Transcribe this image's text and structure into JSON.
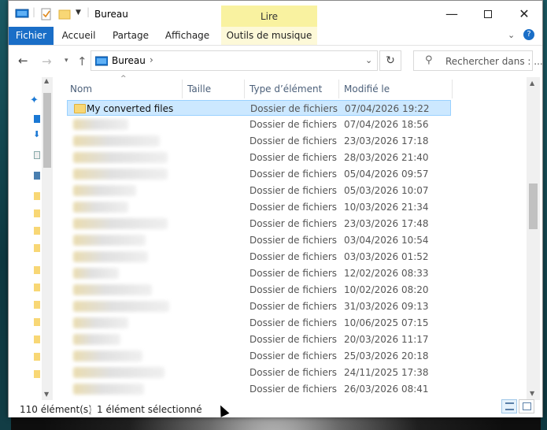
{
  "window": {
    "title": "Bureau",
    "context_tab": "Lire"
  },
  "ribbon": {
    "tabs": [
      "Fichier",
      "Accueil",
      "Partage",
      "Affichage",
      "Outils de musique"
    ]
  },
  "address": {
    "path": "Bureau",
    "search_placeholder": "Rechercher dans : ..."
  },
  "columns": {
    "name": "Nom",
    "size": "Taille",
    "type": "Type d’élément",
    "modified": "Modifié le"
  },
  "rows": [
    {
      "name": "My converted files",
      "type": "Dossier de fichiers",
      "date": "07/04/2026 19:22",
      "selected": true
    },
    {
      "name": "",
      "type": "Dossier de fichiers",
      "date": "07/04/2026 18:56"
    },
    {
      "name": "",
      "type": "Dossier de fichiers",
      "date": "23/03/2026 17:18"
    },
    {
      "name": "",
      "type": "Dossier de fichiers",
      "date": "28/03/2026 21:40"
    },
    {
      "name": "",
      "type": "Dossier de fichiers",
      "date": "05/04/2026 09:57"
    },
    {
      "name": "",
      "type": "Dossier de fichiers",
      "date": "05/03/2026 10:07"
    },
    {
      "name": "",
      "type": "Dossier de fichiers",
      "date": "10/03/2026 21:34"
    },
    {
      "name": "",
      "type": "Dossier de fichiers",
      "date": "23/03/2026 17:48"
    },
    {
      "name": "",
      "type": "Dossier de fichiers",
      "date": "03/04/2026 10:54"
    },
    {
      "name": "",
      "type": "Dossier de fichiers",
      "date": "03/03/2026 01:52"
    },
    {
      "name": "",
      "type": "Dossier de fichiers",
      "date": "12/02/2026 08:33"
    },
    {
      "name": "",
      "type": "Dossier de fichiers",
      "date": "10/02/2026 08:20"
    },
    {
      "name": "",
      "type": "Dossier de fichiers",
      "date": "31/03/2026 09:13"
    },
    {
      "name": "",
      "type": "Dossier de fichiers",
      "date": "10/06/2025 07:15"
    },
    {
      "name": "",
      "type": "Dossier de fichiers",
      "date": "20/03/2026 11:17"
    },
    {
      "name": "",
      "type": "Dossier de fichiers",
      "date": "25/03/2026 20:18"
    },
    {
      "name": "",
      "type": "Dossier de fichiers",
      "date": "24/11/2025 17:38"
    },
    {
      "name": "",
      "type": "Dossier de fichiers",
      "date": "26/03/2026 08:41"
    }
  ],
  "status": {
    "count": "110 élément(s)",
    "selection": "1 élément sélectionné"
  },
  "colors": {
    "file_tab": "#1a6ec7",
    "context_tab": "#f9f2a0",
    "selection": "#cce8ff",
    "folder": "#f8d775"
  }
}
